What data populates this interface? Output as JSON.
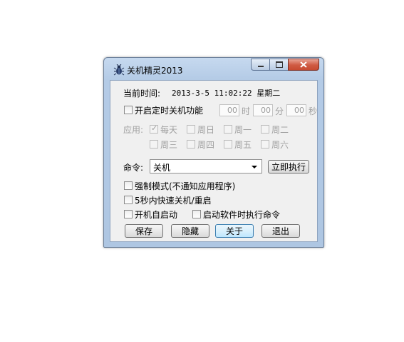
{
  "window": {
    "title": "关机精灵2013",
    "icon": "beetle-app-icon"
  },
  "clock": {
    "label": "当前时间:",
    "value": "2013-3-5 11:02:22 星期二"
  },
  "timer": {
    "enable_label": "开启定时关机功能",
    "enabled": false,
    "hour": "00",
    "hour_unit": "时",
    "minute": "00",
    "minute_unit": "分",
    "second": "00",
    "second_unit": "秒"
  },
  "apply": {
    "label": "应用:",
    "days": [
      {
        "label": "每天",
        "checked": true
      },
      {
        "label": "周日",
        "checked": false
      },
      {
        "label": "周一",
        "checked": false
      },
      {
        "label": "周二",
        "checked": false
      },
      {
        "label": "周三",
        "checked": false
      },
      {
        "label": "周四",
        "checked": false
      },
      {
        "label": "周五",
        "checked": false
      },
      {
        "label": "周六",
        "checked": false
      }
    ]
  },
  "command": {
    "label": "命令:",
    "selected": "关机",
    "execute_label": "立即执行"
  },
  "options": {
    "force": "强制模式(不通知应用程序)",
    "quick": "5秒内快速关机/重启",
    "autostart": "开机自启动",
    "run_on_start": "启动软件时执行命令"
  },
  "buttons": {
    "save": "保存",
    "hide": "隐藏",
    "about": "关于",
    "exit": "退出"
  }
}
